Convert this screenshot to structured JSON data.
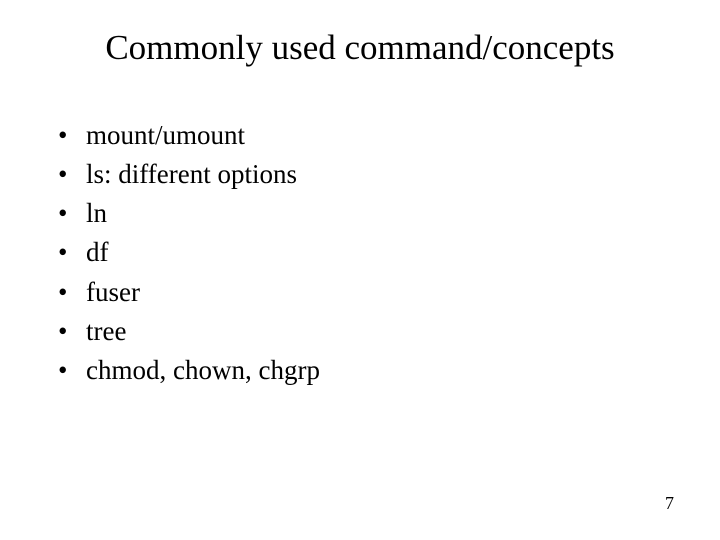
{
  "title": "Commonly used command/concepts",
  "bullets": [
    "mount/umount",
    "ls: different options",
    "ln",
    "df",
    "fuser",
    "tree",
    "chmod, chown, chgrp"
  ],
  "page_number": "7"
}
